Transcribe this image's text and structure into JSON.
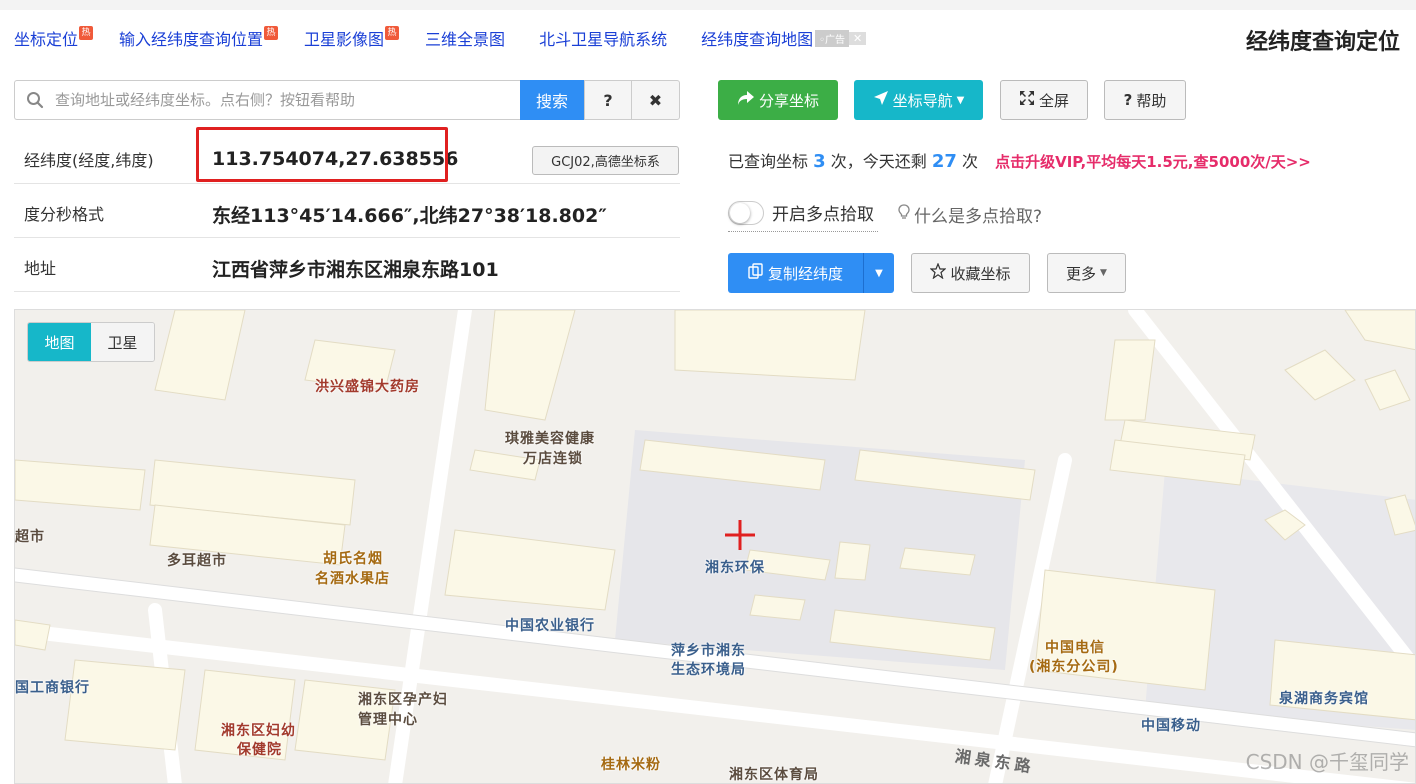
{
  "nav": {
    "items": [
      "坐标定位",
      "输入经纬度查询位置",
      "卫星影像图",
      "三维全景图",
      "北斗卫星导航系统",
      "经纬度查询地图"
    ],
    "hot_label": "热",
    "ad_label": "广告",
    "ad_close": "✕"
  },
  "page_title": "经纬度查询定位",
  "search": {
    "placeholder": "查询地址或经纬度坐标。点右侧？按钮看帮助",
    "search_label": "搜索",
    "help_label": "?",
    "clear_label": "✖"
  },
  "info": {
    "coord_label": "经纬度(经度,纬度)",
    "coord_value": "113.754074,27.638556",
    "coord_system": "GCJ02,高德坐标系",
    "dms_label": "度分秒格式",
    "dms_value": "东经113°45′14.666″,北纬27°38′18.802″",
    "address_label": "地址",
    "address_value": "江西省萍乡市湘东区湘泉东路101"
  },
  "actions": {
    "share": "分享坐标",
    "navigate": "坐标导航",
    "fullscreen": "全屏",
    "help": "帮助"
  },
  "quota": {
    "prefix": "已查询坐标",
    "used": "3",
    "mid": "次，今天还剩",
    "remaining": "27",
    "suffix": "次",
    "vip": "点击升级VIP,平均每天1.5元,查5000次/天>>"
  },
  "multipick": {
    "toggle_label": "开启多点拾取",
    "what_is": "什么是多点拾取?"
  },
  "tools": {
    "copy": "复制经纬度",
    "favorite": "收藏坐标",
    "more": "更多"
  },
  "map": {
    "type_map": "地图",
    "type_satellite": "卫星",
    "pois": [
      "洪兴盛锦大药房",
      "琪雅美容健康",
      "万店连锁",
      "超市",
      "多耳超市",
      "胡氏名烟",
      "名酒水果店",
      "湘东环保",
      "中国农业银行",
      "萍乡市湘东",
      "生态环境局",
      "国工商银行",
      "湘东区孕产妇",
      "管理中心",
      "湘东区妇幼",
      "保健院",
      "桂林米粉",
      "湘东区体育局",
      "中国电信",
      "(湘东分公司)",
      "中国移动",
      "泉湖商务宾馆"
    ],
    "road": "湘泉东路",
    "watermark": "CSDN @千玺同学"
  },
  "colors": {
    "link": "#1a3fd6",
    "primary": "#2f8ef4",
    "share_green": "#3cae46",
    "nav_teal": "#16b7c9",
    "vip_pink": "#e62c6a",
    "highlight_red": "#e02020"
  }
}
